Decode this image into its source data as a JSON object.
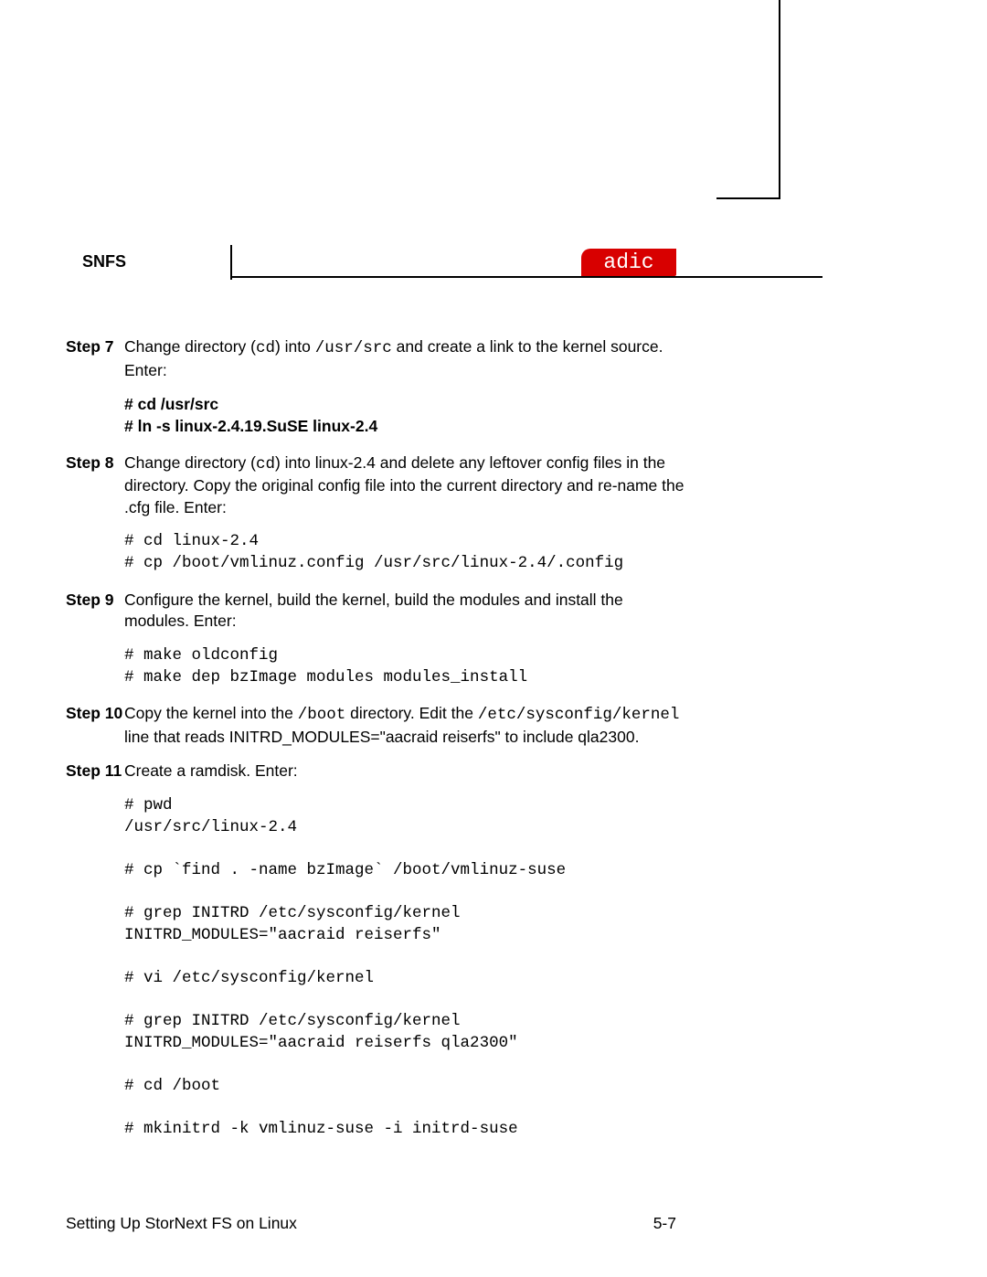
{
  "header": {
    "product": "SNFS",
    "logo_text": "adic"
  },
  "steps": [
    {
      "num": "Step 7",
      "text_pre": "Change directory (",
      "text_cmd_inline": "cd",
      "text_mid": ") into ",
      "text_path_inline": "/usr/src",
      "text_post": " and create a link to the kernel source. Enter:",
      "commands_sans": "# cd /usr/src\n# ln -s linux-2.4.19.SuSE linux-2.4"
    },
    {
      "num": "Step 8",
      "line1_pre": "Change directory (",
      "line1_cmd": "cd",
      "line1_post": ") into linux-2.4 and delete any leftover config files in the directory. Copy the original config file into the current directory and re-name the .cfg file. Enter:",
      "commands_mono": "# cd linux-2.4\n# cp /boot/vmlinuz.config /usr/src/linux-2.4/.config"
    },
    {
      "num": "Step 9",
      "text": "Configure the kernel, build the kernel, build the modules and install the modules. Enter:",
      "commands_mono": "# make oldconfig\n# make dep bzImage modules modules_install"
    },
    {
      "num": "Step 10",
      "seg1": "Copy the kernel into the ",
      "seg2": "/boot",
      "seg3": " directory. Edit the ",
      "seg4": "/etc/sysconfig/kernel",
      "seg5": " line that reads INITRD_MODULES=\"aacraid reiserfs\" to include qla2300."
    },
    {
      "num": "Step 11",
      "text": "Create a ramdisk. Enter:",
      "commands_mono": "# pwd\n/usr/src/linux-2.4\n\n# cp `find . -name bzImage` /boot/vmlinuz-suse\n\n# grep INITRD /etc/sysconfig/kernel\nINITRD_MODULES=\"aacraid reiserfs\"\n\n# vi /etc/sysconfig/kernel\n\n# grep INITRD /etc/sysconfig/kernel\nINITRD_MODULES=\"aacraid reiserfs qla2300\"\n\n# cd /boot\n\n# mkinitrd -k vmlinuz-suse -i initrd-suse"
    }
  ],
  "footer": {
    "left": "Setting Up StorNext FS on Linux",
    "right": "5-7"
  }
}
